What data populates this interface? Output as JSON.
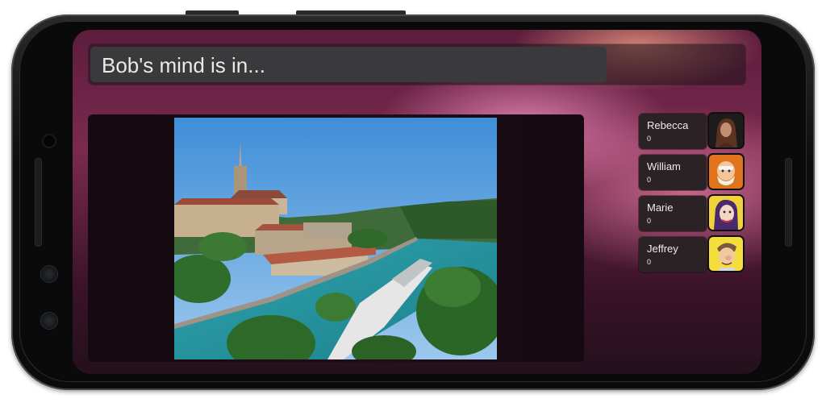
{
  "app": {
    "prompt": "Bob's mind is in...",
    "timer_fraction": 0.79
  },
  "photo": {
    "subject": "city-river-photo"
  },
  "players": [
    {
      "name": "Rebecca",
      "score": "0",
      "avatar_icon": "woman-portrait-avatar"
    },
    {
      "name": "William",
      "score": "0",
      "avatar_icon": "old-man-cartoon-avatar"
    },
    {
      "name": "Marie",
      "score": "0",
      "avatar_icon": "woman-cartoon-avatar"
    },
    {
      "name": "Jeffrey",
      "score": "0",
      "avatar_icon": "man-cartoon-avatar"
    }
  ],
  "colors": {
    "accent_pink": "#e87aa8",
    "panel_dark": "#2b2226"
  }
}
